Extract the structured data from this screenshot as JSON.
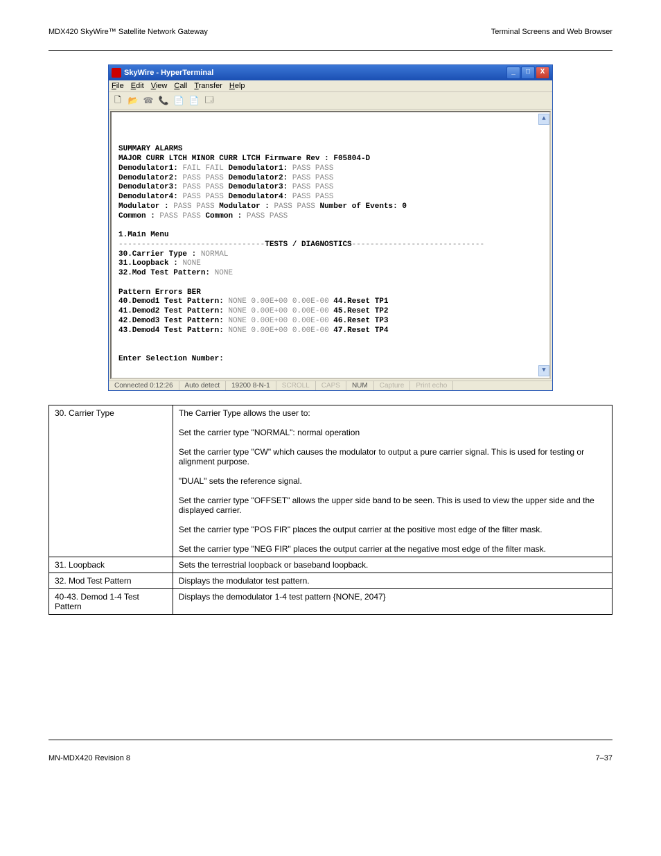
{
  "doc": {
    "hdr_left": "MDX420 SkyWire™ Satellite Network Gateway",
    "hdr_right": "Terminal Screens and Web Browser",
    "ftr_left": "MN-MDX420    Revision 8",
    "ftr_right": "7–37"
  },
  "window": {
    "title": "SkyWire - HyperTerminal",
    "menu": [
      "File",
      "Edit",
      "View",
      "Call",
      "Transfer",
      "Help"
    ]
  },
  "alarms": {
    "heading": "SUMMARY ALARMS",
    "majorLabel": "MAJOR",
    "minorLabel": "MINOR",
    "colhdr": "CURR LTCH",
    "fwLabel": "Firmware Rev :",
    "fwVal": "F05804-D",
    "neLabel": "Number of Events:",
    "neVal": "0",
    "major": [
      {
        "name": "Demodulator1:",
        "val": "FAIL FAIL"
      },
      {
        "name": "Demodulator2:",
        "val": "PASS PASS"
      },
      {
        "name": "Demodulator3:",
        "val": "PASS PASS"
      },
      {
        "name": "Demodulator4:",
        "val": "PASS PASS"
      },
      {
        "name": "Modulator   :",
        "val": "PASS PASS"
      },
      {
        "name": "Common      :",
        "val": "PASS PASS"
      }
    ],
    "minor": [
      {
        "name": "Demodulator1:",
        "val": "PASS PASS"
      },
      {
        "name": "Demodulator2:",
        "val": "PASS PASS"
      },
      {
        "name": "Demodulator3:",
        "val": "PASS PASS"
      },
      {
        "name": "Demodulator4:",
        "val": "PASS PASS"
      },
      {
        "name": "Modulator   :",
        "val": "PASS PASS"
      },
      {
        "name": "Common      :",
        "val": "PASS PASS"
      }
    ]
  },
  "menu": {
    "main": "1.Main Menu",
    "section": "TESTS / DIAGNOSTICS",
    "r30l": "30.Carrier Type    :",
    "r30v": "NORMAL",
    "r31l": "31.Loopback        :",
    "r31v": "NONE",
    "r32l": "32.Mod Test Pattern:",
    "r32v": "NONE",
    "colPattern": "Pattern",
    "colErrors": "Errors",
    "colBER": "BER",
    "rows": [
      {
        "l": "40.Demod1 Test Pattern:",
        "p": "NONE",
        "e": "0.00E+00",
        "b": "0.00E-00",
        "r": "44.Reset TP1"
      },
      {
        "l": "41.Demod2 Test Pattern:",
        "p": "NONE",
        "e": "0.00E+00",
        "b": "0.00E-00",
        "r": "45.Reset TP2"
      },
      {
        "l": "42.Demod3 Test Pattern:",
        "p": "NONE",
        "e": "0.00E+00",
        "b": "0.00E-00",
        "r": "46.Reset TP3"
      },
      {
        "l": "43.Demod4 Test Pattern:",
        "p": "NONE",
        "e": "0.00E+00",
        "b": "0.00E-00",
        "r": "47.Reset TP4"
      }
    ],
    "prompt": "Enter Selection Number:"
  },
  "status": {
    "conn": "Connected 0:12:26",
    "auto": "Auto detect",
    "baud": "19200 8-N-1",
    "scroll": "SCROLL",
    "caps": "CAPS",
    "num": "NUM",
    "capture": "Capture",
    "echo": "Print echo"
  },
  "table": {
    "r1l": "30. Carrier Type",
    "r1d": "The Carrier Type allows the user to:\n\nSet the carrier type \"NORMAL\": normal operation\n\nSet the carrier type \"CW\" which causes the modulator to output a pure carrier signal. This is used for testing or alignment purpose.\n\n\"DUAL\" sets the reference signal.\n\nSet the carrier type \"OFFSET\" allows the upper side band to be seen. This is used to view the upper side and the displayed carrier.\n\nSet the carrier type \"POS FIR\" places the output carrier at the positive most edge of the filter mask.\n\nSet the carrier type \"NEG FIR\" places the output carrier at the negative most edge of the filter mask.",
    "r2l": "31. Loopback",
    "r2d": "Sets the terrestrial loopback or baseband loopback.",
    "r3l": "32. Mod Test Pattern",
    "r3d": "Displays the modulator test pattern.",
    "r4l": "40-43. Demod 1-4 Test Pattern",
    "r4d": "Displays the demodulator 1-4 test pattern {NONE, 2047}"
  }
}
